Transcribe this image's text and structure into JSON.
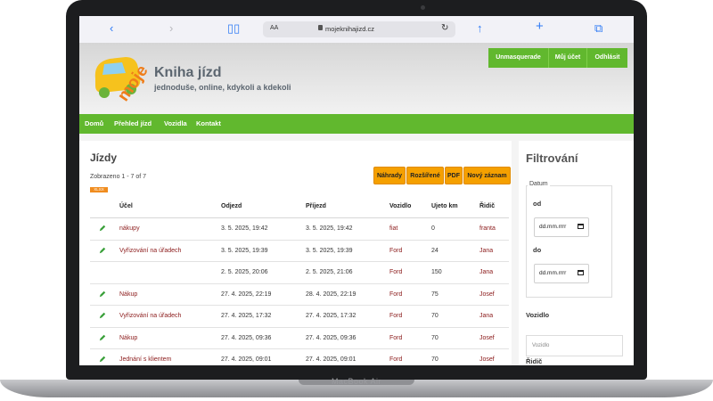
{
  "device": {
    "label": "MacBook Air"
  },
  "browser": {
    "address_aa": "AA",
    "url": "mojeknihajizd.cz"
  },
  "site": {
    "logo_text": "moje",
    "title": "Kniha jízd",
    "subtitle": "jednoduše, online, kdykoli a kdekoli",
    "top_buttons": [
      "Unmasquerade",
      "Můj účet",
      "Odhlásit"
    ],
    "nav": [
      "Domů",
      "Přehled jízd",
      "Vozidla",
      "Kontakt"
    ]
  },
  "main": {
    "title": "Jízdy",
    "count": "Zobrazeno 1 - 7 of 7",
    "xlsx": "XLSX",
    "buttons": [
      "Náhrady",
      "Rozšířené",
      "PDF",
      "Nový záznam"
    ],
    "columns": [
      "Účel",
      "Odjezd",
      "Příjezd",
      "Vozidlo",
      "Ujeto km",
      "Řidič"
    ],
    "rows": [
      {
        "edit": true,
        "ucel": "nákupy",
        "odjezd": "3. 5. 2025, 19:42",
        "prijezd": "3. 5. 2025, 19:42",
        "vozidlo": "fiat",
        "km": "0",
        "ridic": "franta"
      },
      {
        "edit": true,
        "ucel": "Vyřizování na úřadech",
        "odjezd": "3. 5. 2025, 19:39",
        "prijezd": "3. 5. 2025, 19:39",
        "vozidlo": "Ford",
        "km": "24",
        "ridic": "Jana"
      },
      {
        "edit": false,
        "ucel": "",
        "odjezd": "2. 5. 2025, 20:06",
        "prijezd": "2. 5. 2025, 21:06",
        "vozidlo": "Ford",
        "km": "150",
        "ridic": "Jana"
      },
      {
        "edit": true,
        "ucel": "Nákup",
        "odjezd": "27. 4. 2025, 22:19",
        "prijezd": "28. 4. 2025, 22:19",
        "vozidlo": "Ford",
        "km": "75",
        "ridic": "Josef"
      },
      {
        "edit": true,
        "ucel": "Vyřizování na úřadech",
        "odjezd": "27. 4. 2025, 17:32",
        "prijezd": "27. 4. 2025, 17:32",
        "vozidlo": "Ford",
        "km": "70",
        "ridic": "Jana"
      },
      {
        "edit": true,
        "ucel": "Nákup",
        "odjezd": "27. 4. 2025, 09:36",
        "prijezd": "27. 4. 2025, 09:36",
        "vozidlo": "Ford",
        "km": "70",
        "ridic": "Josef"
      },
      {
        "edit": true,
        "ucel": "Jednání s klientem",
        "odjezd": "27. 4. 2025, 09:01",
        "prijezd": "27. 4. 2025, 09:01",
        "vozidlo": "Ford",
        "km": "70",
        "ridic": "Josef"
      }
    ]
  },
  "filter": {
    "title": "Filtrování",
    "datum_legend": "Datum",
    "od_label": "od",
    "do_label": "do",
    "date_placeholder": "dd.mm.rrrr",
    "vozidlo_label": "Vozidlo",
    "vozidlo_placeholder": "Vozidlo",
    "ridic_label": "Řidič"
  },
  "colors": {
    "green": "#61b82e",
    "orange": "#f5a000",
    "link_red": "#8b1a1a"
  }
}
